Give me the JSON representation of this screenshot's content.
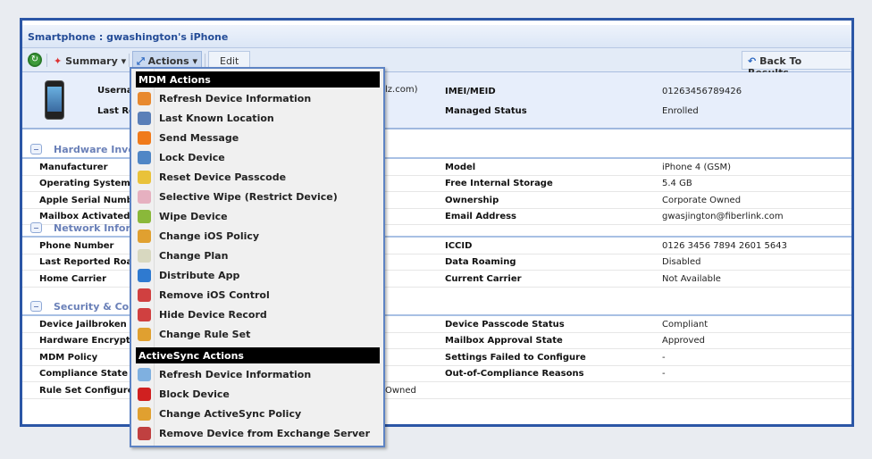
{
  "title": "Smartphone : gwashington's iPhone",
  "toolbar": {
    "summary": "Summary ▾",
    "actions": "Actions ▾",
    "edit": "Edit",
    "back": "Back To Results"
  },
  "header": {
    "username_label": "Usernar",
    "username_value": "lz.com)",
    "last_label": "Last Rep",
    "imei_label": "IMEI/MEID",
    "imei_value": "01263456789426",
    "managed_label": "Managed Status",
    "managed_value": "Enrolled"
  },
  "sections": [
    {
      "title": "Hardware Inve",
      "rows": [
        [
          "Manufacturer",
          "",
          "Model",
          "iPhone 4 (GSM)"
        ],
        [
          "Operating System",
          "",
          "Free Internal Storage",
          "5.4 GB"
        ],
        [
          "Apple Serial Number",
          "",
          "Ownership",
          "Corporate Owned"
        ],
        [
          "Mailbox Activated",
          "",
          "Email Address",
          "gwasjington@fiberlink.com"
        ]
      ]
    },
    {
      "title": "Network Inforr",
      "rows": [
        [
          "Phone Number",
          "",
          "ICCID",
          "0126 3456 7894 2601 5643"
        ],
        [
          "Last Reported Roam",
          "",
          "Data Roaming",
          "Disabled"
        ],
        [
          "Home Carrier",
          "",
          "Current Carrier",
          "Not Available"
        ]
      ]
    },
    {
      "title": "Security & Com",
      "rows": [
        [
          "Device Jailbroken",
          "",
          "Device Passcode Status",
          "Compliant"
        ],
        [
          "Hardware Encryptio",
          "",
          "Mailbox Approval State",
          "Approved"
        ],
        [
          "MDM Policy",
          "",
          "Settings Failed to Configure",
          "-"
        ],
        [
          "Compliance State",
          "",
          "Out-of-Compliance Reasons",
          "-"
        ],
        [
          "Rule Set Configured",
          "Owned",
          "",
          ""
        ]
      ]
    }
  ],
  "menu": {
    "mdm_header": "MDM Actions",
    "mdm_items": [
      {
        "label": "Refresh Device Information",
        "icon": "apple-refresh-icon",
        "color": "#e8892e"
      },
      {
        "label": "Last Known Location",
        "icon": "magnifier-icon",
        "color": "#5a7fb8"
      },
      {
        "label": "Send Message",
        "icon": "rss-icon",
        "color": "#f07a1a"
      },
      {
        "label": "Lock Device",
        "icon": "lock-icon",
        "color": "#4f86c6"
      },
      {
        "label": "Reset Device Passcode",
        "icon": "key-icon",
        "color": "#e9c23a"
      },
      {
        "label": "Selective Wipe (Restrict Device)",
        "icon": "eraser-icon",
        "color": "#e6b0c0"
      },
      {
        "label": "Wipe Device",
        "icon": "wipe-icon",
        "color": "#8ab83a"
      },
      {
        "label": "Change iOS Policy",
        "icon": "pencil-icon",
        "color": "#e0a030"
      },
      {
        "label": "Change Plan",
        "icon": "notepad-icon",
        "color": "#d8d8c0"
      },
      {
        "label": "Distribute App",
        "icon": "arrow-right-icon",
        "color": "#2f7ad0"
      },
      {
        "label": "Remove iOS Control",
        "icon": "remove-device-icon",
        "color": "#d04040"
      },
      {
        "label": "Hide Device Record",
        "icon": "hide-device-icon",
        "color": "#d04040"
      },
      {
        "label": "Change Rule Set",
        "icon": "pencil-icon",
        "color": "#e0a030"
      }
    ],
    "as_header": "ActiveSync Actions",
    "as_items": [
      {
        "label": "Refresh Device Information",
        "icon": "refresh-icon",
        "color": "#7fb0e0"
      },
      {
        "label": "Block Device",
        "icon": "block-icon",
        "color": "#d02020"
      },
      {
        "label": "Change ActiveSync Policy",
        "icon": "pencil-icon",
        "color": "#e0a030"
      },
      {
        "label": "Remove Device from Exchange Server",
        "icon": "remove-exchange-icon",
        "color": "#c04040"
      }
    ]
  }
}
